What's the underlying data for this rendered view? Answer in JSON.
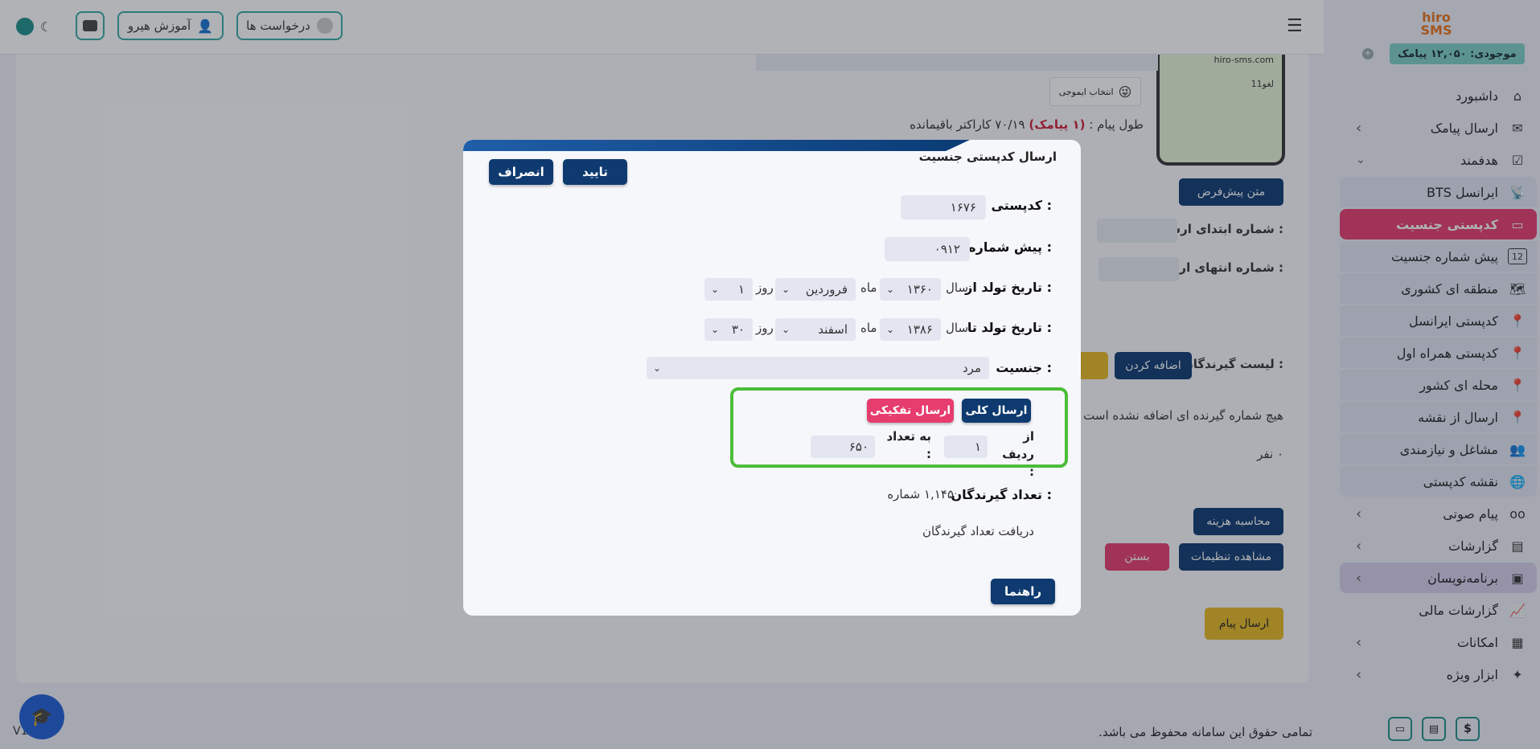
{
  "topbar": {
    "requests_label": "درخواست ها",
    "training_label": "آموزش هیرو",
    "menu_icon": "hamburger-icon",
    "user_icon": "user-icon",
    "briefcase_icon": "briefcase-icon",
    "theme_icon": "moon-icon"
  },
  "sidebar": {
    "logo_text": "hiro SMS",
    "balance": "موجودی: ۱۲,۰۵۰ پیامک",
    "items": [
      {
        "label": "داشبورد",
        "icon": "home-icon"
      },
      {
        "label": "ارسال پیامک",
        "icon": "sms-icon"
      },
      {
        "label": "هدفمند",
        "icon": "target-icon"
      },
      {
        "label": "BTS ایرانسل",
        "icon": "antenna-icon"
      },
      {
        "label": "کدپستی جنسیت",
        "icon": "id-card-icon"
      },
      {
        "label": "پیش شماره جنسیت",
        "icon": "number-icon"
      },
      {
        "label": "منطقه ای کشوری",
        "icon": "map-icon"
      },
      {
        "label": "کدپستی ایرانسل",
        "icon": "map-pin-icon"
      },
      {
        "label": "کدپستی همراه اول",
        "icon": "map-pin-icon"
      },
      {
        "label": "محله ای کشور",
        "icon": "map-pin-icon"
      },
      {
        "label": "ارسال از نقشه",
        "icon": "map-pin-icon"
      },
      {
        "label": "مشاغل و نیازمندی",
        "icon": "users-icon"
      },
      {
        "label": "نقشه کدپستی",
        "icon": "globe-icon"
      },
      {
        "label": "پیام صوتی",
        "icon": "voicemail-icon"
      },
      {
        "label": "گزارشات",
        "icon": "report-icon"
      },
      {
        "label": "برنامه‌نویسان",
        "icon": "code-icon"
      },
      {
        "label": "گزارشات مالی",
        "icon": "chart-icon"
      },
      {
        "label": "امکانات",
        "icon": "calculator-icon"
      },
      {
        "label": "ابزار ویژه",
        "icon": "sparkle-icon"
      }
    ]
  },
  "background": {
    "preview_site": "hiro-sms.com",
    "preview_cancel": "لغو11",
    "emoji_button": "انتخاب ایموجی",
    "message_length_prefix": "طول پیام :",
    "message_length_count": "(۱ پیامک)",
    "message_length_suffix": "۷۰/۱۹ کاراکتر باقیمانده",
    "default_text_button": "متن پیش‌فرض",
    "start_number_label": "شماره ابتدای ارسال :",
    "end_number_label": "شماره انتهای ارسال :",
    "recipients_label": "لیست گیرندگان :",
    "add_button": "اضافه کردن",
    "no_recipient_text": "هیچ شماره گیرنده ای اضافه نشده است",
    "zero_people": "۰ نفر",
    "calc_cost_button": "محاسبه هزینه",
    "view_settings_button": "مشاهده تنظیمات",
    "close_button": "بستن",
    "send_message_button": "ارسال پیام",
    "copyright": "تمامی حقوق این سامانه محفوظ می باشد.",
    "version": "V1.1.02"
  },
  "modal": {
    "title": "ارسال کدپستی جنسیت",
    "confirm_button": "تایید",
    "cancel_button": "انصراف",
    "postal_label": "کدپستی :",
    "postal_value": "۱۶۷۶",
    "prefix_label": "پیش شماره :",
    "prefix_value": "۰۹۱۲",
    "birth_from_label": "تاریخ تولد از :",
    "birth_to_label": "تاریخ تولد تا :",
    "year_word": "سال",
    "month_word": "ماه",
    "day_word": "روز",
    "from_year": "۱۳۶۰",
    "from_month": "فروردین",
    "from_day": "۱",
    "to_year": "۱۳۸۶",
    "to_month": "اسفند",
    "to_day": "۳۰",
    "gender_label": "جنسیت :",
    "gender_value": "مرد",
    "send_all_button": "ارسال کلی",
    "send_split_button": "ارسال تفکیکی",
    "from_row_label": "از ردیف :",
    "from_row_value": "۱",
    "count_label": "به تعداد :",
    "count_value": "۶۵۰",
    "recipient_count_label": "تعداد گیرندگان :",
    "recipient_count_value": "۱,۱۴۵ شماره",
    "get_count_link": "دریافت تعداد گیرندگان",
    "help_button": "راهنما"
  },
  "colors": {
    "navy": "#0e3a70",
    "active_pink": "#e63c6e",
    "teal": "#3aa9a3",
    "yellow": "#e8b923",
    "green_border": "#4cbd3a"
  }
}
